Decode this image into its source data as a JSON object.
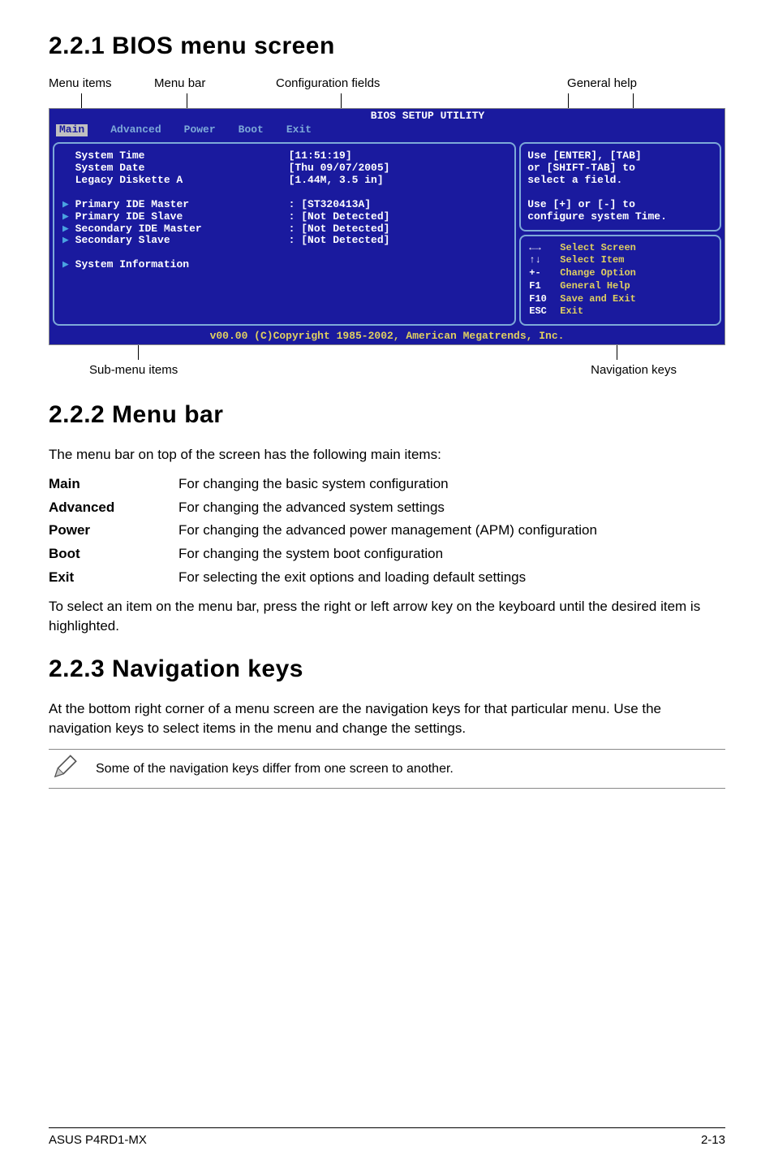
{
  "headings": {
    "h221": "2.2.1   BIOS menu screen",
    "h222": "2.2.2   Menu bar",
    "h223": "2.2.3   Navigation keys"
  },
  "diagram_labels": {
    "menu_items": "Menu items",
    "menu_bar": "Menu bar",
    "config_fields": "Configuration fields",
    "general_help": "General help",
    "sub_menu": "Sub-menu items",
    "nav_keys": "Navigation keys"
  },
  "bios": {
    "title": "BIOS SETUP UTILITY",
    "tabs": [
      "Main",
      "Advanced",
      "Power",
      "Boot",
      "Exit"
    ],
    "left_labels": [
      "System Time",
      "System Date",
      "Legacy Diskette A",
      "",
      "Primary IDE Master",
      "Primary IDE Slave",
      "Secondary IDE Master",
      "Secondary Slave",
      "",
      "System Information"
    ],
    "left_values": [
      "[11:51:19]",
      "[Thu 09/07/2005]",
      "[1.44M, 3.5 in]",
      "",
      ": [ST320413A]",
      ": [Not Detected]",
      ": [Not Detected]",
      ": [Not Detected]",
      "",
      ""
    ],
    "arrows": [
      false,
      false,
      false,
      false,
      true,
      true,
      true,
      true,
      false,
      true
    ],
    "help_text": "Use [ENTER], [TAB]\nor [SHIFT-TAB] to\nselect a field.\n\nUse [+] or [-] to\nconfigure system Time.",
    "nav": [
      {
        "k": "←→",
        "v": "Select Screen"
      },
      {
        "k": "↑↓",
        "v": "Select Item"
      },
      {
        "k": "+-",
        "v": "Change Option"
      },
      {
        "k": "F1",
        "v": "General Help"
      },
      {
        "k": "F10",
        "v": "Save and Exit"
      },
      {
        "k": "ESC",
        "v": "Exit"
      }
    ],
    "footer": "v00.00 (C)Copyright 1985-2002, American Megatrends, Inc."
  },
  "section222": {
    "intro": "The menu bar on top of the screen has the following main items:",
    "rows": [
      {
        "k": "Main",
        "v": "For changing the basic system configuration"
      },
      {
        "k": "Advanced",
        "v": "For changing the advanced system settings"
      },
      {
        "k": "Power",
        "v": "For changing the advanced power management (APM) configuration"
      },
      {
        "k": "Boot",
        "v": "For changing the system boot configuration"
      },
      {
        "k": "Exit",
        "v": "For selecting the exit options and loading default settings"
      }
    ],
    "outro": "To select an item on the menu bar, press the right or left arrow key on the keyboard until the desired item is highlighted."
  },
  "section223": {
    "para": "At the bottom right corner of a menu screen are the navigation keys for that particular menu. Use the navigation keys to select items in the menu and change the settings.",
    "note": "Some of the navigation keys differ from one screen to another."
  },
  "footer": {
    "left": "ASUS P4RD1-MX",
    "right": "2-13"
  }
}
